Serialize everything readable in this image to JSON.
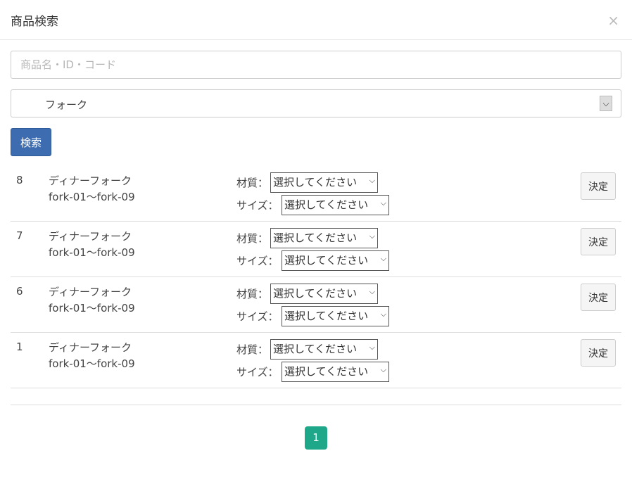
{
  "modal": {
    "title": "商品検索",
    "close_icon": "×"
  },
  "search": {
    "placeholder": "商品名・ID・コード",
    "value": ""
  },
  "category": {
    "selected": "フォーク"
  },
  "search_button": "検索",
  "results": [
    {
      "num": "8",
      "name": "ディナーフォーク",
      "code": "fork-01〜fork-09",
      "material_label": "材質：",
      "material_value": "選択してください",
      "size_label": "サイズ：",
      "size_value": "選択してください",
      "decide": "決定"
    },
    {
      "num": "7",
      "name": "ディナーフォーク",
      "code": "fork-01〜fork-09",
      "material_label": "材質：",
      "material_value": "選択してください",
      "size_label": "サイズ：",
      "size_value": "選択してください",
      "decide": "決定"
    },
    {
      "num": "6",
      "name": "ディナーフォーク",
      "code": "fork-01〜fork-09",
      "material_label": "材質：",
      "material_value": "選択してください",
      "size_label": "サイズ：",
      "size_value": "選択してください",
      "decide": "決定"
    },
    {
      "num": "1",
      "name": "ディナーフォーク",
      "code": "fork-01〜fork-09",
      "material_label": "材質：",
      "material_value": "選択してください",
      "size_label": "サイズ：",
      "size_value": "選択してください",
      "decide": "決定"
    }
  ],
  "pagination": {
    "current": "1"
  },
  "colors": {
    "primary": "#3d6db0",
    "page_active": "#1ea889"
  }
}
